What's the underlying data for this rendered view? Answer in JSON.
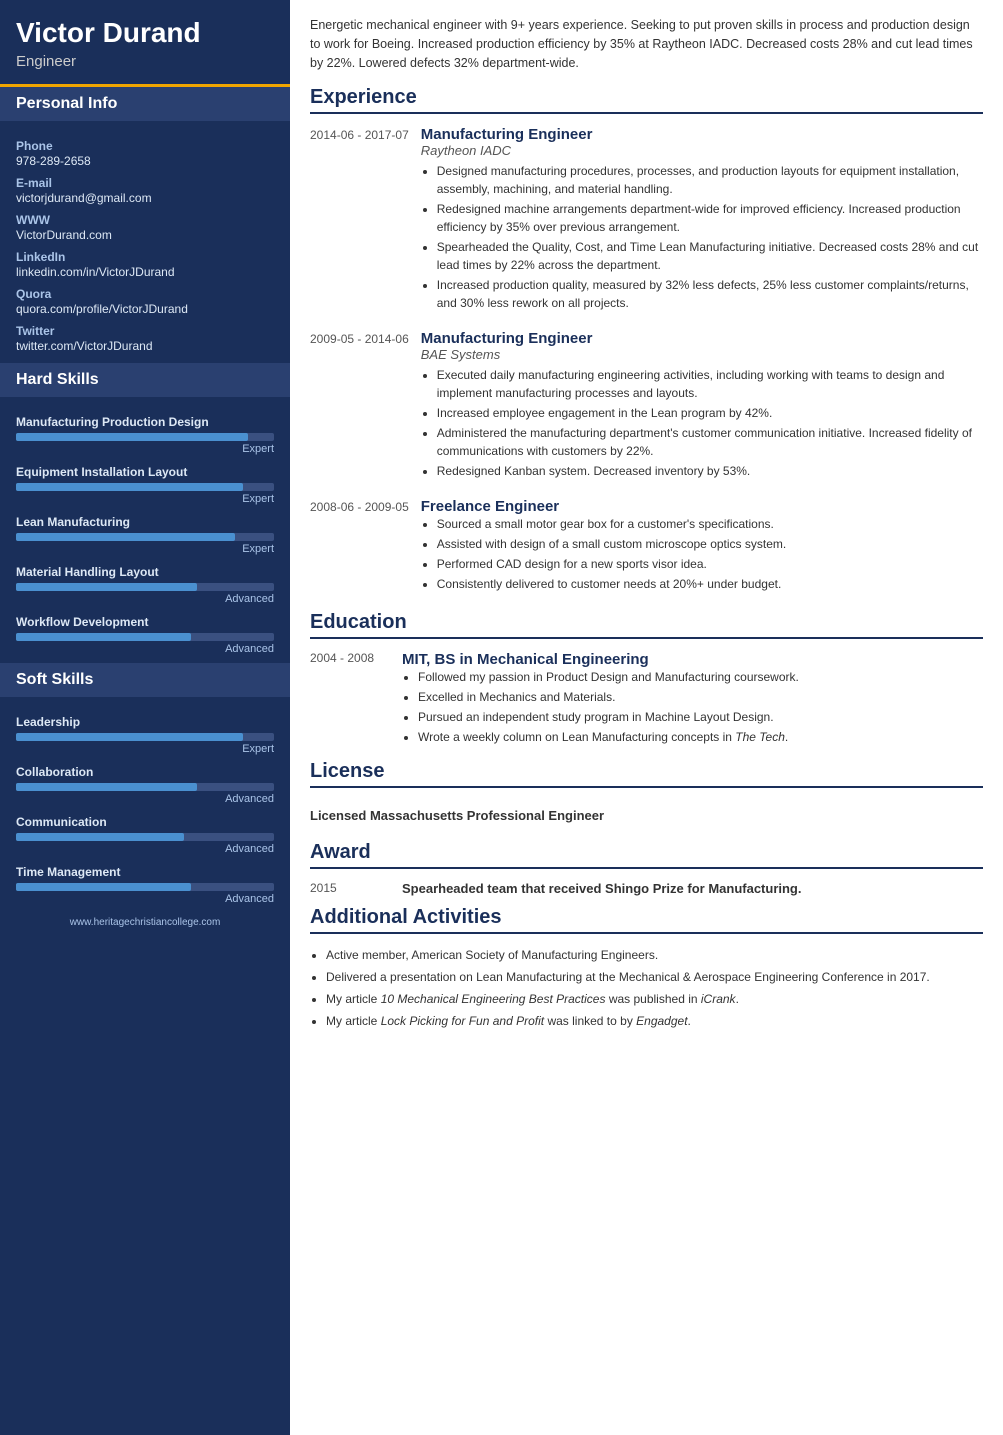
{
  "sidebar": {
    "name": "Victor Durand",
    "title": "Engineer",
    "personal_info_label": "Personal Info",
    "phone_label": "Phone",
    "phone_value": "978-289-2658",
    "email_label": "E-mail",
    "email_value": "victorjdurand@gmail.com",
    "www_label": "WWW",
    "www_value": "VictorDurand.com",
    "linkedin_label": "LinkedIn",
    "linkedin_value": "linkedin.com/in/VictorJDurand",
    "quora_label": "Quora",
    "quora_value": "quora.com/profile/VictorJDurand",
    "twitter_label": "Twitter",
    "twitter_value": "twitter.com/VictorJDurand",
    "hard_skills_label": "Hard Skills",
    "hard_skills": [
      {
        "name": "Manufacturing Production Design",
        "pct": 90,
        "level": "Expert"
      },
      {
        "name": "Equipment Installation Layout",
        "pct": 88,
        "level": "Expert"
      },
      {
        "name": "Lean Manufacturing",
        "pct": 85,
        "level": "Expert"
      },
      {
        "name": "Material Handling Layout",
        "pct": 70,
        "level": "Advanced"
      },
      {
        "name": "Workflow Development",
        "pct": 68,
        "level": "Advanced"
      }
    ],
    "soft_skills_label": "Soft Skills",
    "soft_skills": [
      {
        "name": "Leadership",
        "pct": 88,
        "level": "Expert"
      },
      {
        "name": "Collaboration",
        "pct": 70,
        "level": "Advanced"
      },
      {
        "name": "Communication",
        "pct": 65,
        "level": "Advanced"
      },
      {
        "name": "Time Management",
        "pct": 68,
        "level": "Advanced"
      }
    ],
    "footer": "www.heritagechristiancollege.com"
  },
  "main": {
    "summary": "Energetic mechanical engineer with 9+ years experience. Seeking to put proven skills in process and production design to work for Boeing. Increased production efficiency by 35% at Raytheon IADC. Decreased costs 28% and cut lead times by 22%. Lowered defects 32% department-wide.",
    "experience_label": "Experience",
    "experience": [
      {
        "dates": "2014-06 - 2017-07",
        "title": "Manufacturing Engineer",
        "company": "Raytheon IADC",
        "bullets": [
          "Designed manufacturing procedures, processes, and production layouts for equipment installation, assembly, machining, and material handling.",
          "Redesigned machine arrangements department-wide for improved efficiency. Increased production efficiency by 35% over previous arrangement.",
          "Spearheaded the Quality, Cost, and Time Lean Manufacturing initiative. Decreased costs 28% and cut lead times by 22% across the department.",
          "Increased production quality, measured by 32% less defects, 25% less customer complaints/returns, and 30% less rework on all projects."
        ]
      },
      {
        "dates": "2009-05 - 2014-06",
        "title": "Manufacturing Engineer",
        "company": "BAE Systems",
        "bullets": [
          "Executed daily manufacturing engineering activities, including working with teams to design and implement manufacturing processes and layouts.",
          "Increased employee engagement in the Lean program by 42%.",
          "Administered the manufacturing department's customer communication initiative. Increased fidelity of communications with customers by 22%.",
          "Redesigned Kanban system. Decreased inventory by 53%."
        ]
      },
      {
        "dates": "2008-06 - 2009-05",
        "title": "Freelance Engineer",
        "company": "",
        "bullets": [
          "Sourced a small motor gear box for a customer's specifications.",
          "Assisted with design of a small custom microscope optics system.",
          "Performed CAD design for a new sports visor idea.",
          "Consistently delivered to customer needs at 20%+ under budget."
        ]
      }
    ],
    "education_label": "Education",
    "education": [
      {
        "dates": "2004 - 2008",
        "degree": "MIT, BS in Mechanical Engineering",
        "bullets": [
          "Followed my passion in Product Design and Manufacturing coursework.",
          "Excelled in Mechanics and Materials.",
          "Pursued an independent study program in Machine Layout Design.",
          "Wrote a weekly column on Lean Manufacturing concepts in The Tech."
        ]
      }
    ],
    "license_label": "License",
    "license_text": "Licensed Massachusetts Professional Engineer",
    "award_label": "Award",
    "award": {
      "year": "2015",
      "text": "Spearheaded team that received Shingo Prize for Manufacturing."
    },
    "additional_label": "Additional Activities",
    "additional_bullets": [
      "Active member, American Society of Manufacturing Engineers.",
      "Delivered a presentation on Lean Manufacturing at the Mechanical & Aerospace Engineering Conference in 2017.",
      "My article 10 Mechanical Engineering Best Practices was published in iCrank.",
      "My article Lock Picking for Fun and Profit was linked to by Engadget."
    ]
  }
}
